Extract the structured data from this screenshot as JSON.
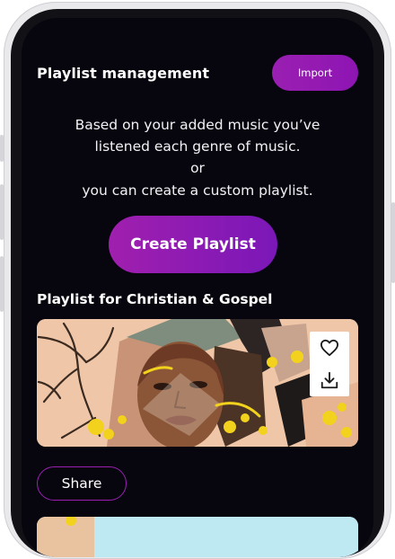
{
  "header": {
    "title": "Playlist management",
    "import_label": "Import"
  },
  "description": {
    "line1": "Based on your added music you’ve",
    "line2": "listened each genre of music.",
    "line3": "or",
    "line4": "you can create a custom playlist."
  },
  "create_label": "Create Playlist",
  "playlist": {
    "title": "Playlist for Christian & Gospel",
    "like_icon": "heart-icon",
    "download_icon": "download-icon",
    "share_label": "Share"
  },
  "colors": {
    "background": "#07060f",
    "accent": "#9a1fb2",
    "accent_dark": "#7b17b8"
  }
}
